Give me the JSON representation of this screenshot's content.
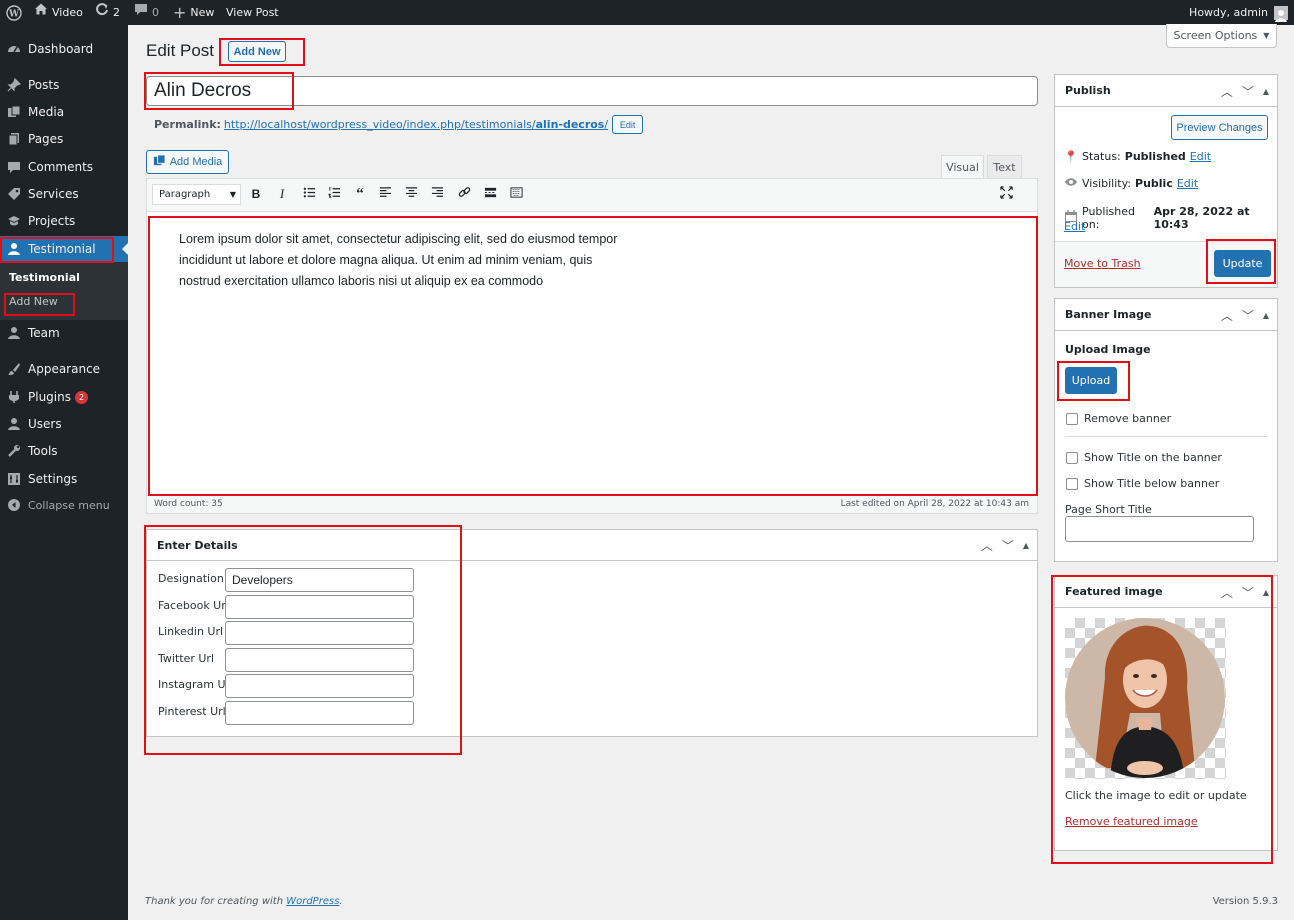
{
  "adminbar": {
    "site_name": "Video",
    "updates_count": "2",
    "comments_count": "0",
    "new_label": "New",
    "view_post_label": "View Post",
    "howdy": "Howdy, admin"
  },
  "sidebar": {
    "dashboard": "Dashboard",
    "posts": "Posts",
    "media": "Media",
    "pages": "Pages",
    "comments": "Comments",
    "services": "Services",
    "projects": "Projects",
    "testimonial": "Testimonial",
    "sub_testimonial": "Testimonial",
    "sub_add_new": "Add New",
    "team": "Team",
    "appearance": "Appearance",
    "plugins": "Plugins",
    "plugins_badge": "2",
    "users": "Users",
    "tools": "Tools",
    "settings": "Settings",
    "collapse": "Collapse menu"
  },
  "header": {
    "title": "Edit Post",
    "add_new": "Add New",
    "screen_options": "Screen Options"
  },
  "post": {
    "title": "Alin Decros",
    "permalink_label": "Permalink:",
    "permalink_base": "http://localhost/wordpress_video/index.php/testimonials/",
    "permalink_slug": "alin-decros",
    "permalink_trail": "/",
    "permalink_edit": "Edit"
  },
  "editor": {
    "add_media": "Add Media",
    "tab_visual": "Visual",
    "tab_text": "Text",
    "format_select": "Paragraph",
    "content_line1": "Lorem ipsum dolor sit amet, consectetur adipiscing elit, sed do eiusmod tempor",
    "content_line2": "incididunt ut labore et dolore magna aliqua. Ut enim ad minim veniam, quis",
    "content_line3": "nostrud exercitation ullamco laboris nisi ut aliquip ex ea commodo",
    "word_count": "Word count: 35",
    "last_edited": "Last edited on April 28, 2022 at 10:43 am"
  },
  "details": {
    "title": "Enter Details",
    "fields": [
      {
        "label": "Designation",
        "value": "Developers"
      },
      {
        "label": "Facebook Url",
        "value": ""
      },
      {
        "label": "Linkedin Url",
        "value": ""
      },
      {
        "label": "Twitter Url",
        "value": ""
      },
      {
        "label": "Instagram Url",
        "value": ""
      },
      {
        "label": "Pinterest Url",
        "value": ""
      }
    ]
  },
  "publish": {
    "title": "Publish",
    "preview": "Preview Changes",
    "status_label": "Status:",
    "status_value": "Published",
    "visibility_label": "Visibility:",
    "visibility_value": "Public",
    "published_label": "Published on:",
    "published_value": "Apr 28, 2022 at 10:43",
    "edit": "Edit",
    "trash": "Move to Trash",
    "update": "Update"
  },
  "banner": {
    "title": "Banner Image",
    "upload_heading": "Upload Image",
    "upload_button": "Upload",
    "remove_banner": "Remove banner",
    "show_title_on": "Show Title on the banner",
    "show_title_below": "Show Title below banner",
    "short_title_label": "Page Short Title",
    "short_title_value": ""
  },
  "featured": {
    "title": "Featured image",
    "hint": "Click the image to edit or update",
    "remove": "Remove featured image"
  },
  "footer": {
    "thanks_prefix": "Thank you for creating with ",
    "wordpress": "WordPress",
    "thanks_suffix": ".",
    "version": "Version 5.9.3"
  },
  "colors": {
    "accent": "#2271b1",
    "highlight": "#e20f17",
    "sidebar": "#1d2327"
  }
}
